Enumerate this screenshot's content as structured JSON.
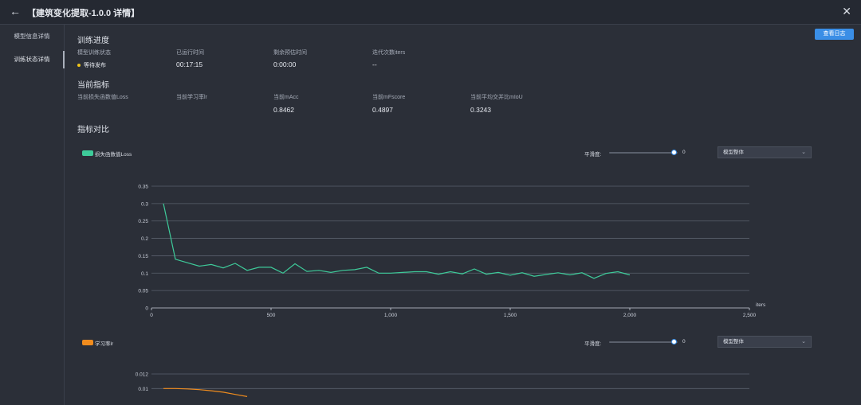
{
  "header": {
    "title": "【建筑变化提取-1.0.0 详情】"
  },
  "sidebar": {
    "items": [
      {
        "label": "模型信息详情"
      },
      {
        "label": "训练状态详情"
      }
    ]
  },
  "actions": {
    "view_log": "查看日志"
  },
  "progress": {
    "title": "训练进度",
    "labels": {
      "status": "模型训练状态",
      "elapsed": "已运行时间",
      "remaining": "剩余预估时间",
      "iters": "迭代次数iters"
    },
    "values": {
      "status": "等待发布",
      "elapsed": "00:17:15",
      "remaining": "0:00:00",
      "iters": "--"
    },
    "colors": {
      "status_dot": "#f0c419"
    }
  },
  "metrics": {
    "title": "当前指标",
    "labels": {
      "loss": "当前损失函数值Loss",
      "lr": "当前学习率lr",
      "macc": "当前mAcc",
      "mfscore": "当前mFscore",
      "miou": "当前平均交并比mIoU"
    },
    "values": {
      "loss": "",
      "lr": "",
      "macc": "0.8462",
      "mfscore": "0.4897",
      "miou": "0.3243"
    }
  },
  "comparison": {
    "title": "指标对比"
  },
  "charts": [
    {
      "legend": "损失函数值Loss",
      "smoothing_label": "平滑度:",
      "smoothing_value": "0",
      "smoothing_level": 0,
      "select_value": "模型整体",
      "color": "#3ecb9a"
    },
    {
      "legend": "学习率lr",
      "smoothing_label": "平滑度:",
      "smoothing_value": "0",
      "smoothing_level": 0,
      "select_value": "模型整体",
      "color": "#f08c1e"
    }
  ],
  "chart_data": [
    {
      "type": "line",
      "xlabel": "iters",
      "xlim": [
        0,
        2500
      ],
      "ylim": [
        0,
        0.35
      ],
      "x_ticks": [
        0,
        500,
        1000,
        1500,
        2000,
        2500
      ],
      "x_tick_labels": [
        "0",
        "500",
        "1,000",
        "1,500",
        "2,000",
        "2,500"
      ],
      "y_ticks": [
        0,
        0.05,
        0.1,
        0.15,
        0.2,
        0.25,
        0.3,
        0.35
      ],
      "y_tick_labels": [
        "0",
        "0.05",
        "0.1",
        "0.15",
        "0.2",
        "0.25",
        "0.3",
        "0.35"
      ],
      "grid": true,
      "series": [
        {
          "x": [
            50,
            100,
            150,
            200,
            250,
            300,
            350,
            400,
            450,
            500,
            550,
            600,
            650,
            700,
            750,
            800,
            850,
            900,
            950,
            1000,
            1050,
            1100,
            1150,
            1200,
            1250,
            1300,
            1350,
            1400,
            1450,
            1500,
            1550,
            1600,
            1650,
            1700,
            1750,
            1800,
            1850,
            1900,
            1950,
            2000
          ],
          "values": [
            0.3,
            0.14,
            0.13,
            0.12,
            0.125,
            0.115,
            0.128,
            0.108,
            0.117,
            0.117,
            0.1,
            0.127,
            0.105,
            0.108,
            0.102,
            0.108,
            0.11,
            0.117,
            0.1,
            0.1,
            0.102,
            0.104,
            0.104,
            0.097,
            0.104,
            0.098,
            0.112,
            0.097,
            0.102,
            0.094,
            0.101,
            0.091,
            0.096,
            0.101,
            0.095,
            0.101,
            0.085,
            0.099,
            0.104,
            0.095
          ]
        }
      ]
    },
    {
      "type": "line",
      "xlim": [
        0,
        2500
      ],
      "ylim": [
        0,
        0.012
      ],
      "y_ticks": [
        0.01,
        0.012
      ],
      "y_tick_labels": [
        "0.01",
        "0.012"
      ],
      "grid": true,
      "series": [
        {
          "x": [
            50,
            100,
            150,
            200,
            250,
            300,
            350,
            400
          ],
          "values": [
            0.01,
            0.01,
            0.00995,
            0.00985,
            0.0097,
            0.0095,
            0.0092,
            0.0089
          ]
        }
      ]
    }
  ]
}
